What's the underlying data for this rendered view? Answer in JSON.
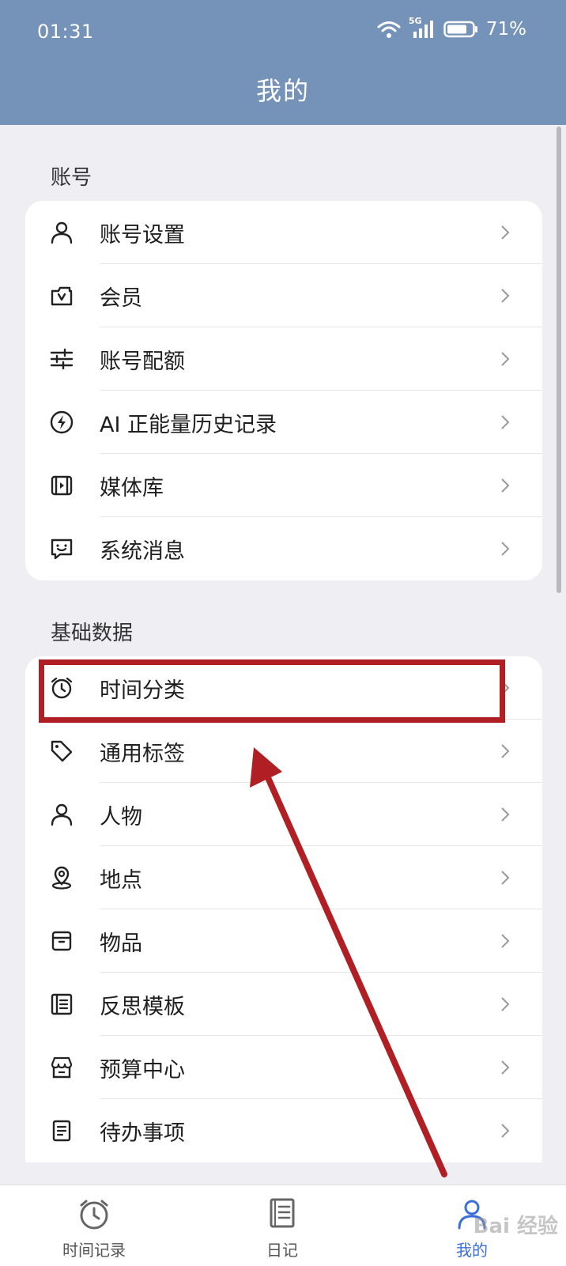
{
  "status_bar": {
    "time": "01:31",
    "network": "5G",
    "battery": "71%"
  },
  "header": {
    "title": "我的"
  },
  "sections": [
    {
      "title": "账号",
      "items": [
        {
          "label": "账号设置",
          "icon": "person-icon"
        },
        {
          "label": "会员",
          "icon": "membership-icon"
        },
        {
          "label": "账号配额",
          "icon": "sliders-icon"
        },
        {
          "label": "AI 正能量历史记录",
          "icon": "lightning-icon"
        },
        {
          "label": "媒体库",
          "icon": "media-icon"
        },
        {
          "label": "系统消息",
          "icon": "message-icon"
        }
      ]
    },
    {
      "title": "基础数据",
      "items": [
        {
          "label": "时间分类",
          "icon": "alarm-clock-icon"
        },
        {
          "label": "通用标签",
          "icon": "tag-icon"
        },
        {
          "label": "人物",
          "icon": "person-icon"
        },
        {
          "label": "地点",
          "icon": "location-pin-icon"
        },
        {
          "label": "物品",
          "icon": "box-icon"
        },
        {
          "label": "反思模板",
          "icon": "list-template-icon"
        },
        {
          "label": "预算中心",
          "icon": "store-icon"
        },
        {
          "label": "待办事项",
          "icon": "todo-icon"
        }
      ]
    }
  ],
  "tabbar": {
    "tabs": [
      {
        "label": "时间记录",
        "icon": "alarm-clock-icon",
        "active": false
      },
      {
        "label": "日记",
        "icon": "notebook-icon",
        "active": false
      },
      {
        "label": "我的",
        "icon": "person-icon",
        "active": true
      }
    ]
  },
  "annotation": {
    "highlight_color": "#b01f24"
  },
  "watermark": {
    "text": "Bai 经验"
  },
  "colors": {
    "header_bg": "#7592b8",
    "page_bg": "#eeeef3",
    "active_tab": "#3a6fd8"
  }
}
